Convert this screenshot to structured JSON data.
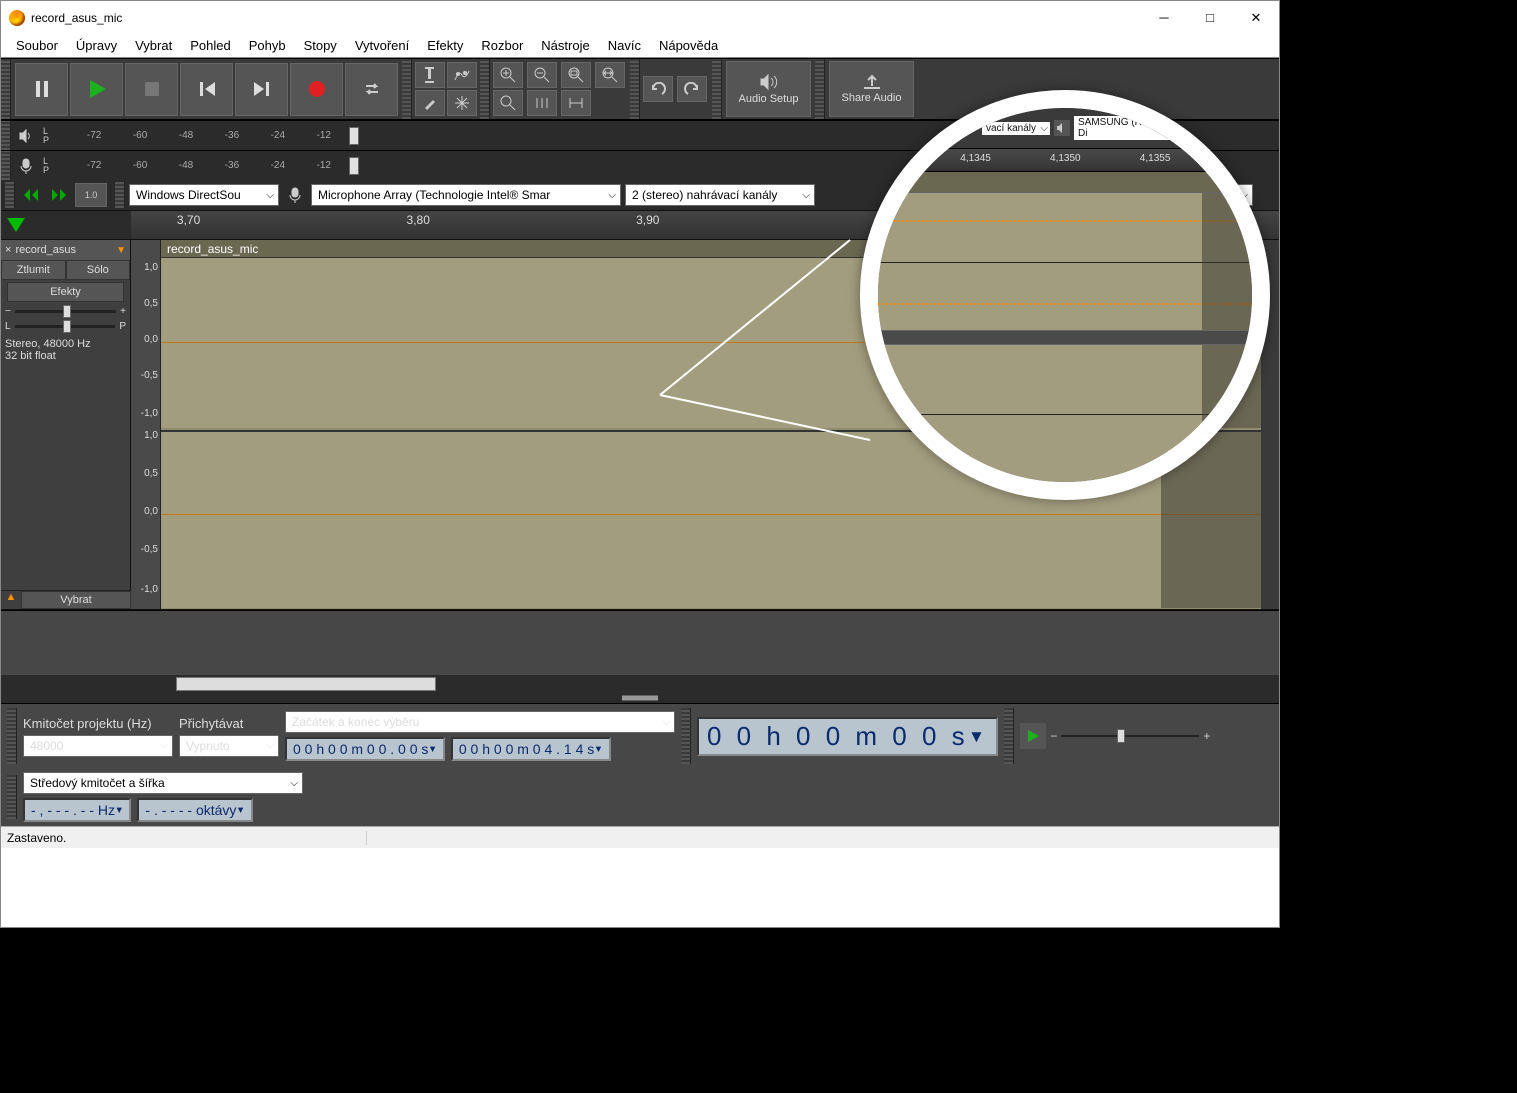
{
  "window": {
    "title": "record_asus_mic"
  },
  "menubar": [
    "Soubor",
    "Úpravy",
    "Vybrat",
    "Pohled",
    "Pohyb",
    "Stopy",
    "Vytvoření",
    "Efekty",
    "Rozbor",
    "Nástroje",
    "Navíc",
    "Nápověda"
  ],
  "toolbar": {
    "audio_setup": "Audio Setup",
    "share_audio": "Share Audio"
  },
  "meters": {
    "playback_ticks": [
      "-72",
      "-60",
      "-48",
      "-36",
      "-24",
      "-12"
    ],
    "record_ticks": [
      "-72",
      "-60",
      "-48",
      "-36",
      "-24",
      "-12"
    ],
    "channels": [
      "L",
      "P"
    ]
  },
  "devices": {
    "host": "Windows DirectSou",
    "rec_device": "Microphone Array (Technologie Intel® Smar",
    "rec_channels": "2 (stereo) nahrávací kanály",
    "play_device_visible": "d"
  },
  "timeline": {
    "labels": [
      "3,70",
      "3,80",
      "3,90"
    ]
  },
  "track": {
    "close": "×",
    "name": "record_asus",
    "mute": "Ztlumit",
    "solo": "Sólo",
    "efx": "Efekty",
    "gain_minus": "−",
    "gain_plus": "+",
    "pan_l": "L",
    "pan_r": "P",
    "info1": "Stereo, 48000 Hz",
    "info2": "32 bit float",
    "select": "Vybrat",
    "amp_labels": [
      "1,0",
      "0,5",
      "0,0",
      "-0,5",
      "-1,0",
      "1,0",
      "0,5",
      "0,0",
      "-0,5",
      "-1,0"
    ],
    "clip_label": "record_asus_mic"
  },
  "bottom": {
    "project_rate_label": "Kmitočet projektu (Hz)",
    "project_rate": "48000",
    "snap_label": "Přichytávat",
    "snap": "Vypnuto",
    "selection_mode": "Začátek a konec výběru",
    "sel_start": "0 0 h 0 0 m 0 0 . 0 0 s",
    "sel_end": "0 0 h 0 0 m 0 4 . 1 4 s",
    "position": "0 0 h 0 0 m 0 0 s",
    "freq_mode": "Středový kmitočet a šířka",
    "freq_val1": "- , - - - . - -  Hz",
    "freq_val2": "- . - - - -  oktávy",
    "speed_minus": "−",
    "speed_plus": "+"
  },
  "status": {
    "text": "Zastaveno."
  },
  "magnifier": {
    "channels_label": "vací kanály",
    "output_device": "SAMSUNG (HD Audio Driver for Di",
    "ruler": [
      "4,1345",
      "4,1350",
      "4,1355"
    ]
  }
}
